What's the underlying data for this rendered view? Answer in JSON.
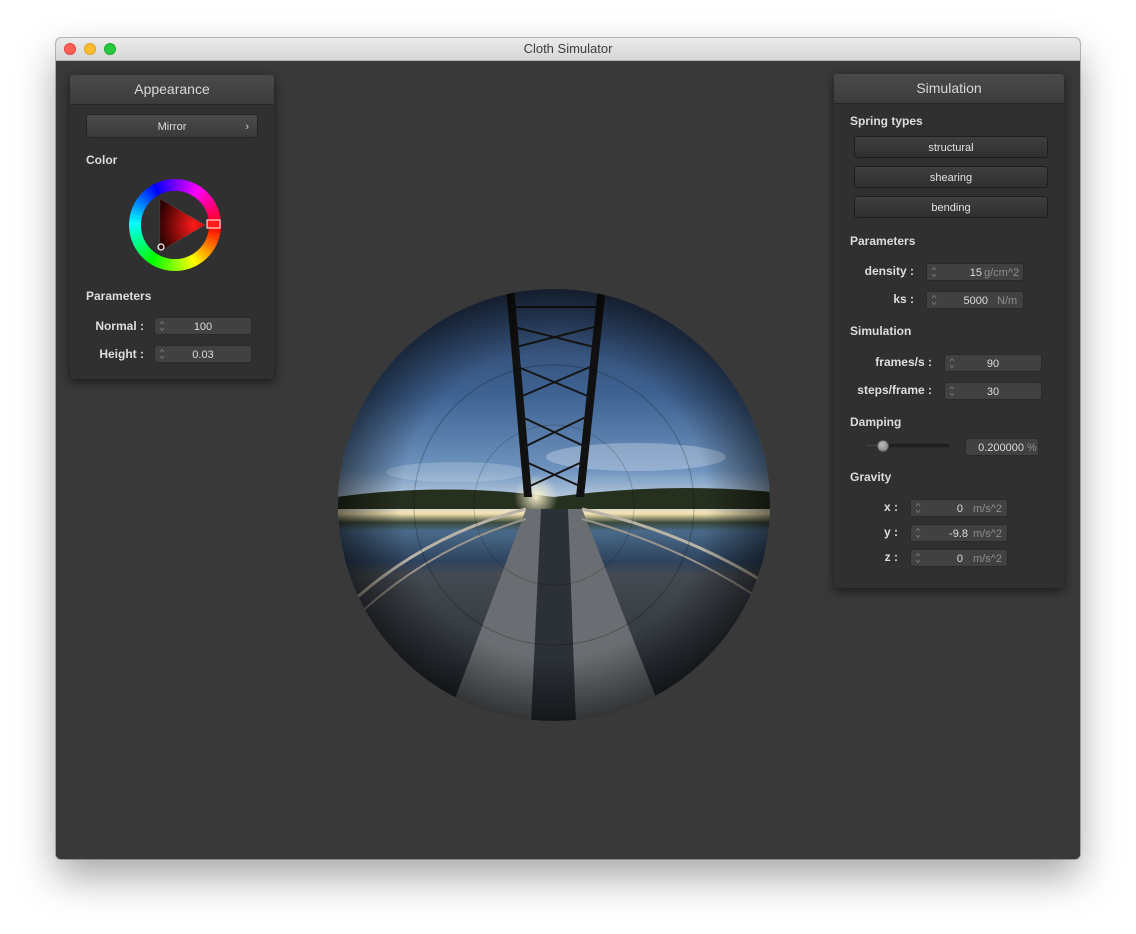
{
  "window": {
    "title": "Cloth Simulator"
  },
  "appearance": {
    "title": "Appearance",
    "shader": "Mirror",
    "color_label": "Color",
    "selected_hue_color": "#ff1a1a",
    "parameters_label": "Parameters",
    "normal": {
      "label": "Normal :",
      "value": "100"
    },
    "height": {
      "label": "Height :",
      "value": "0.03"
    }
  },
  "simulation": {
    "title": "Simulation",
    "spring_types_label": "Spring types",
    "spring_types": [
      "structural",
      "shearing",
      "bending"
    ],
    "parameters_label": "Parameters",
    "density": {
      "label": "density :",
      "value": "15",
      "unit": "g/cm^2"
    },
    "ks": {
      "label": "ks :",
      "value": "5000",
      "unit": "N/m"
    },
    "simulation_label": "Simulation",
    "frames_per_s": {
      "label": "frames/s :",
      "value": "90"
    },
    "steps_per_frame": {
      "label": "steps/frame :",
      "value": "30"
    },
    "damping_label": "Damping",
    "damping": {
      "value": "0.200000",
      "unit": "%",
      "slider_fraction": 0.2
    },
    "gravity_label": "Gravity",
    "gravity": {
      "x": {
        "label": "x :",
        "value": "0",
        "unit": "m/s^2"
      },
      "y": {
        "label": "y :",
        "value": "-9.8",
        "unit": "m/s^2"
      },
      "z": {
        "label": "z :",
        "value": "0",
        "unit": "m/s^2"
      }
    }
  },
  "viewport": {
    "background": "#393939",
    "object": "mirror-sphere"
  }
}
